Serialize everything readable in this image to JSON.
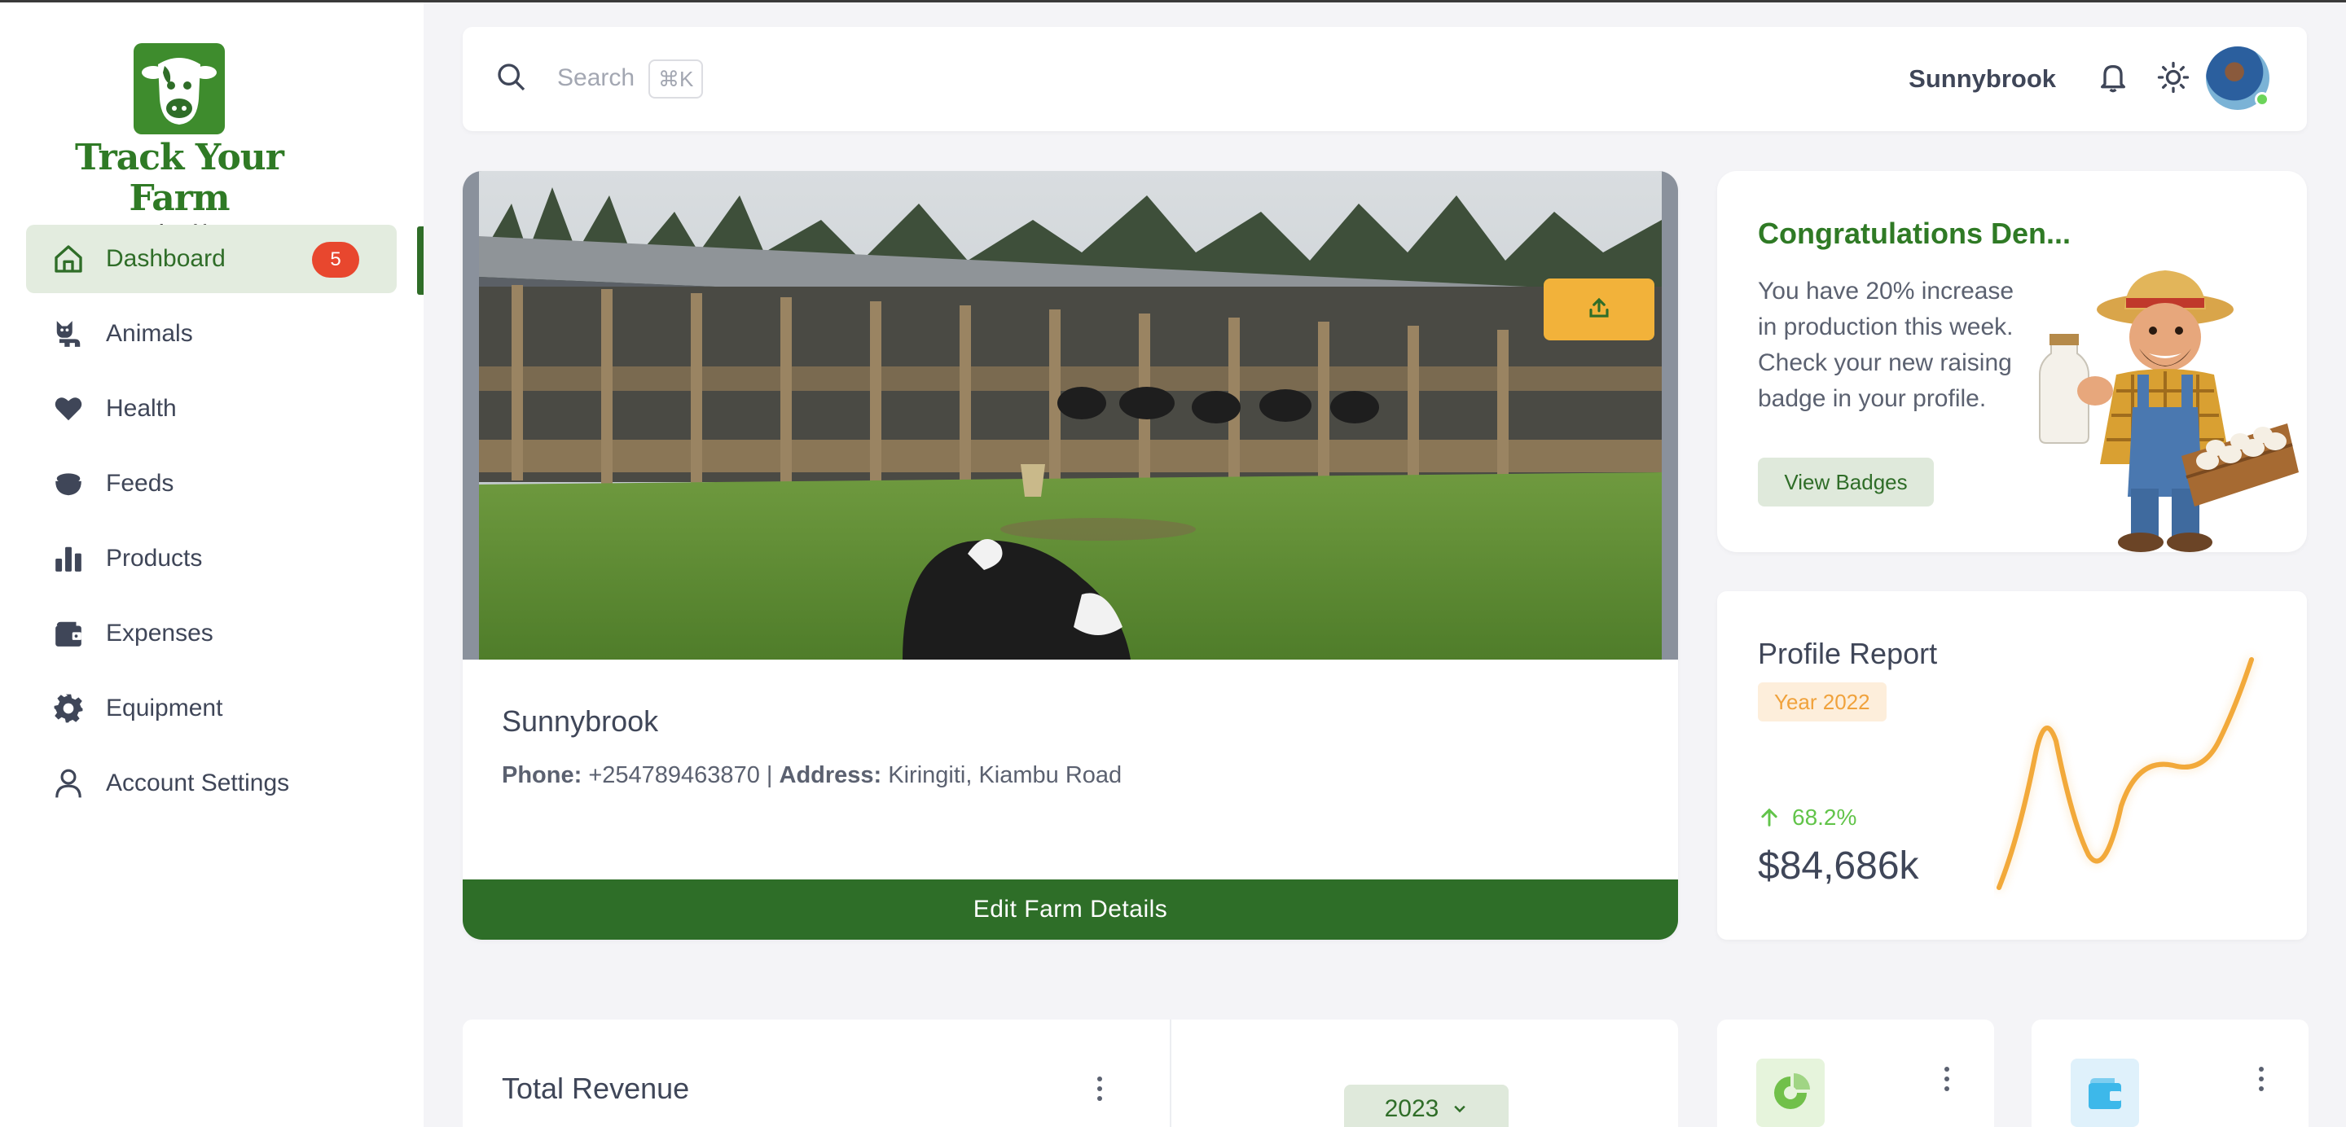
{
  "brand": {
    "title": "Track Your Farm",
    "tagline": "Run your farm like a CEO"
  },
  "sidebar": {
    "items": [
      {
        "label": "Dashboard",
        "icon": "home-icon",
        "badge": "5",
        "active": true
      },
      {
        "label": "Animals",
        "icon": "cat-icon"
      },
      {
        "label": "Health",
        "icon": "heart-icon"
      },
      {
        "label": "Feeds",
        "icon": "feed-bowl-icon"
      },
      {
        "label": "Products",
        "icon": "bar-chart-icon"
      },
      {
        "label": "Expenses",
        "icon": "wallet-icon"
      },
      {
        "label": "Equipment",
        "icon": "gear-icon"
      },
      {
        "label": "Account Settings",
        "icon": "user-icon"
      }
    ]
  },
  "topbar": {
    "search_placeholder": "Search",
    "shortcut": "⌘K",
    "farm_name": "Sunnybrook"
  },
  "farm_card": {
    "name": "Sunnybrook",
    "phone_label": "Phone:",
    "phone": "+254789463870",
    "separator": "|",
    "address_label": "Address:",
    "address": "Kiringiti, Kiambu Road",
    "edit_label": "Edit Farm Details"
  },
  "congrats": {
    "title": "Congratulations Den...",
    "text": "You have 20% increase in production this week. Check your new raising badge in your profile.",
    "button": "View Badges"
  },
  "report": {
    "title": "Profile Report",
    "year": "Year 2022",
    "growth": "68.2%",
    "value": "$84,686k"
  },
  "revenue": {
    "title": "Total Revenue",
    "year_select": "2023"
  },
  "colors": {
    "brand_green": "#2e6e28",
    "accent_orange": "#f2b23a",
    "badge_red": "#e8472e",
    "growth_green": "#62c44a"
  }
}
